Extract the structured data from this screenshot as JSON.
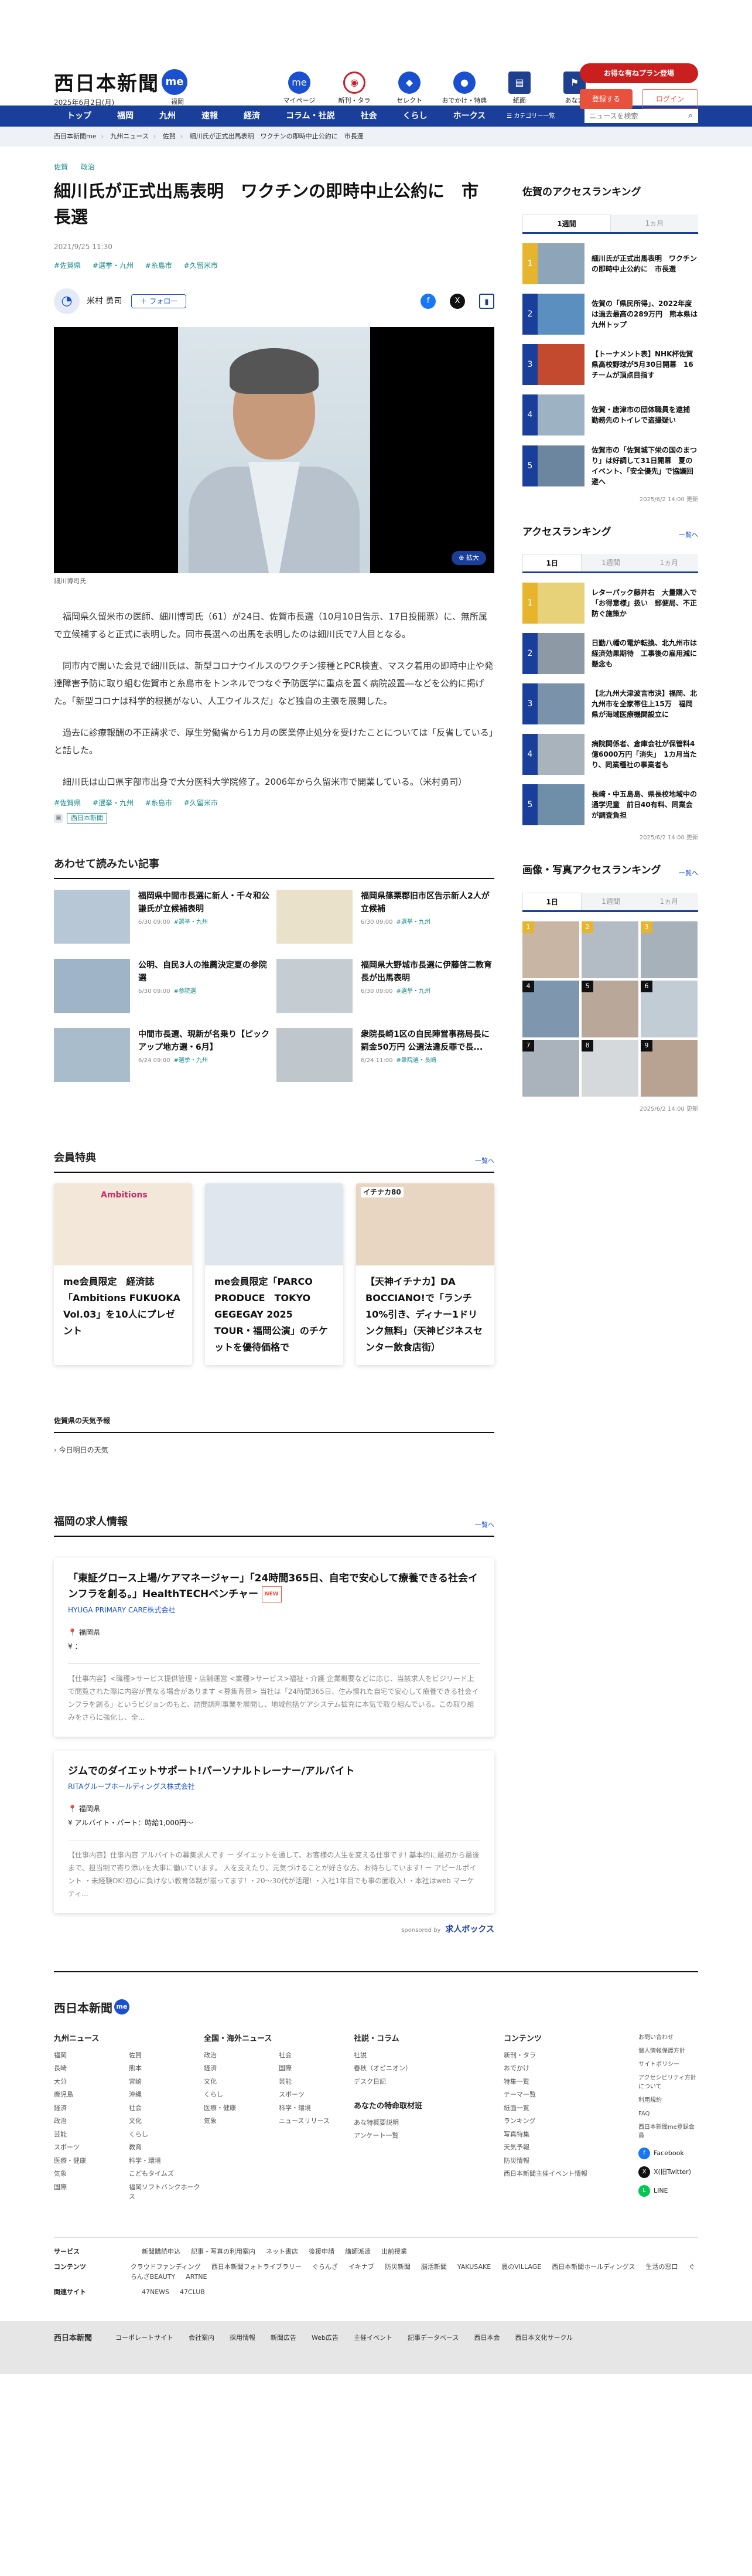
{
  "header": {
    "logo": "西日本新聞",
    "logo_badge": "me",
    "date": "2025年6月2日(月)",
    "weather": "福岡",
    "icons": [
      {
        "label": "マイページ",
        "icon": "me-icon"
      },
      {
        "label": "新刊・タラ",
        "icon": "clock-icon"
      },
      {
        "label": "セレクト",
        "icon": "tag-icon"
      },
      {
        "label": "おでかけ・特典",
        "icon": "foot-icon"
      },
      {
        "label": "紙面",
        "icon": "paper-icon"
      },
      {
        "label": "あな吉",
        "icon": "hawks-icon"
      }
    ],
    "promo_button": "お得な有ねプラン登場",
    "register_button": "登録する",
    "login_button": "ログイン"
  },
  "nav": {
    "items": [
      "トップ",
      "福岡",
      "九州",
      "速報",
      "経済",
      "コラム・社説",
      "社会",
      "くらし",
      "ホークス"
    ],
    "category_label": "カテゴリー一覧",
    "search_placeholder": "ニュースを検索"
  },
  "breadcrumb": [
    "西日本新聞me",
    "九州ニュース",
    "佐賀",
    "細川氏が正式出馬表明　ワクチンの即時中止公約に　市長選"
  ],
  "article": {
    "top_tags": [
      "佐賀",
      "政治"
    ],
    "title": "細川氏が正式出馬表明　ワクチンの即時中止公約に　市長選",
    "date": "2021/9/25 11:30",
    "tags": [
      "#佐賀県",
      "#選挙・九州",
      "#糸島市",
      "#久留米市"
    ],
    "author": "米村 勇司",
    "follow": "＋ フォロー",
    "zoom": "拡大",
    "caption": "細川博司氏",
    "paragraphs": [
      "福岡県久留米市の医師、細川博司氏（61）が24日、佐賀市長選（10月10日告示、17日投開票）に、無所属で立候補すると正式に表明した。同市長選への出馬を表明したのは細川氏で7人目となる。",
      "同市内で開いた会見で細川氏は、新型コロナウイルスのワクチン接種とPCR検査、マスク着用の即時中止や発達障害予防に取り組む佐賀市と糸島市をトンネルでつなぐ予防医学に重点を置く病院設置―などを公約に掲げた。「新型コロナは科学的根拠がない、人工ウイルスだ」など独自の主張を展開した。",
      "過去に診療報酬の不正請求で、厚生労働省から1カ月の医業停止処分を受けたことについては「反省している」と話した。",
      "細川氏は山口県宇部市出身で大分医科大学院修了。2006年から久留米市で開業している。（米村勇司）"
    ],
    "bottom_tags": [
      "#佐賀県",
      "#選挙・九州",
      "#糸島市",
      "#久留米市"
    ],
    "source": "西日本新聞"
  },
  "related": {
    "heading": "あわせて読みたい記事",
    "items": [
      {
        "title": "福岡県中間市長選に新人・千々和公謙氏が立候補表明",
        "date": "6/30 09:00",
        "tag": "#選挙・九州"
      },
      {
        "title": "福岡県篠栗郡旧市区告示新人2人が立候補",
        "date": "6/30 09:00",
        "tag": "#選挙・九州"
      },
      {
        "title": "公明、自民3人の推薦決定夏の参院選",
        "date": "6/30 09:00",
        "tag": "#参院選"
      },
      {
        "title": "福岡県大野城市長選に伊藤啓二教育長が出馬表明",
        "date": "6/30 09:00",
        "tag": "#選挙・九州"
      },
      {
        "title": "中間市長選、現新が名乗り【ピックアップ地方選・6月】",
        "date": "6/24 09:00",
        "tag": "#選挙・九州"
      },
      {
        "title": "衆院長崎1区の自民陣営事務局長に罰金50万円 公選法違反罪で長...",
        "date": "6/24 11:00",
        "tag": "#衆院選・長崎"
      }
    ]
  },
  "members": {
    "heading": "会員特典",
    "more": "一覧へ",
    "cards": [
      "me会員限定　経済誌「Ambitions FUKUOKA Vol.03」を10人にプレゼント",
      "me会員限定「PARCO PRODUCE　TOKYO GEGEGAY 2025 TOUR・福岡公演」のチケットを優待価格で",
      "【天神イチナカ】DA BOCCIANO!で「ランチ10%引き、ディナー1ドリンク無料」（天神ビジネスセンター飲食店街）"
    ],
    "card_badges": [
      "Ambitions",
      "",
      "イチナカ80"
    ]
  },
  "weather": {
    "heading": "佐賀県の天気予報",
    "sub": "今日明日の天気"
  },
  "jobs": {
    "heading": "福岡の求人情報",
    "more": "一覧へ",
    "items": [
      {
        "title": "「東証グロース上場/ケアマネージャー」「24時間365日、自宅で安心して療養できる社会インフラを創る。」HealthTECHベンチャー",
        "badge": "NEW",
        "company": "HYUGA PRIMARY CARE株式会社",
        "location": "福岡県",
        "salary": "：",
        "desc": "【仕事内容】<職種>サービス提供管理・店舗運営 <業種>サービス>福祉・介護 企業概要などに応じ、当該求人をビジリード上で閲覧された際に内容が異なる場合があります <募集背景> 当社は「24時間365日、住み慣れた自宅で安心して療養できる社会インフラを創る」というビジョンのもと、訪問調剤事業を展開し、地域包括ケアシステム拡充に本気で取り組んでいる。この取り組みをさらに強化し、全..."
      },
      {
        "title": "ジムでのダイエットサポート!パーソナルトレーナー/アルバイト",
        "badge": "",
        "company": "RITAグループホールディングス株式会社",
        "location": "福岡県",
        "salary": "アルバイト・パート：時給1,000円～",
        "desc": "【仕事内容】仕事内容 アルバイトの募集求人です ー ダイエットを通して、お客様の人生を変える仕事です! 基本的に最初から最後まで、担当制で寄り添いを大事に働いています。 人を支えたり、元気づけることが好きな方、お待ちしています! ー アピールポイント ・未経験OK!初心に負けない教育体制が揃ってます! ・20～30代が活躍! ・入社1年目でも事の面収入! ・本社はweb マーケティ..."
      }
    ],
    "sponsored": "sponsored by",
    "sponsor_name": "求人ボックス"
  },
  "sidebar": {
    "saga_ranking": {
      "heading": "佐賀のアクセスランキング",
      "tabs": [
        "1週間",
        "1ヵ月"
      ],
      "items": [
        "細川氏が正式出馬表明　ワクチンの即時中止公約に　市長選",
        "佐賀の「県民所得」、2022年度は過去最高の289万円　熊本県は九州トップ",
        "【トーナメント表】NHK杯佐賀県高校野球が5月30日開幕　16チームが頂点目指す",
        "佐賀・唐津市の団体職員を逮捕　勤務先のトイレで盗撮疑い",
        "佐賀市の「佐賀城下栄の国のまつり」は好調して31日開幕　夏のイベント、「安全優先」で協議回避へ"
      ],
      "updated": "2025/6/2 14:00 更新"
    },
    "access_ranking": {
      "heading": "アクセスランキング",
      "more": "一覧へ",
      "tabs": [
        "1日",
        "1週間",
        "1ヵ月"
      ],
      "items": [
        "レターパック藤井右　大量購入で「お得意様」扱い　郵便局、不正防ぐ施策か",
        "日勤八幡の電炉転換、北九州市は経済効果期待　工事後の雇用減に懸念も",
        "【北九州大津波言市決】福岡、北九州市を全家帯住上15万　福岡県が海域医療機関設立に",
        "病院関係者、倉庫会社が保管料4億6000万円「消失」　1カ月当たり、同業種社の事業者も",
        "長崎・中五島島、県長校地域中の通学児童　前日40有料、同業会が調査負担"
      ],
      "updated": "2025/6/2 14:00 更新"
    },
    "photo_ranking": {
      "heading": "画像・写真アクセスランキング",
      "more": "一覧へ",
      "tabs": [
        "1日",
        "1週間",
        "1ヵ月"
      ],
      "count": 9,
      "updated": "2025/6/2 14:00 更新"
    }
  },
  "footer": {
    "logo": "西日本新聞",
    "columns": [
      {
        "heading": "九州ニュース",
        "links": [
          "福岡",
          "佐賀",
          "長崎",
          "熊本",
          "大分",
          "宮崎",
          "鹿児島",
          "沖縄",
          "経済",
          "社会",
          "政治",
          "文化",
          "芸能",
          "くらし",
          "スポーツ",
          "教育",
          "医療・健康",
          "科学・環境",
          "気象",
          "こどもタイムズ",
          "国際",
          "福岡ソフトバンクホークス"
        ]
      },
      {
        "heading": "全国・海外ニュース",
        "links": [
          "政治",
          "社会",
          "経済",
          "国際",
          "文化",
          "芸能",
          "くらし",
          "スポーツ",
          "医療・健康",
          "科学・環境",
          "気象",
          "ニュースリリース"
        ]
      },
      {
        "heading": "社説・コラム",
        "links": [
          "社説",
          "春秋（オピニオン）",
          "デスク日記"
        ]
      },
      {
        "heading": "コンテンツ",
        "links": [
          "新刊・タラ",
          "おでかけ",
          "特集一覧",
          "テーマ一覧",
          "紙面一覧",
          "ランキング",
          "写真特集",
          "天気予報",
          "防災情報",
          "西日本新聞主催イベント情報"
        ]
      }
    ],
    "col3b_heading": "あなたの特命取材班",
    "col3b_links": [
      "あな特概要説明",
      "アンケート一覧"
    ],
    "small_links": [
      "お問い合わせ",
      "個人情報保護方針",
      "サイトポリシー",
      "アクセシビリティ方針について",
      "利用規約",
      "FAQ",
      "西日本新聞me登録会員"
    ],
    "sns": [
      "Facebook",
      "X(旧Twitter)",
      "LINE"
    ],
    "rows": [
      {
        "key": "サービス",
        "values": [
          "新聞購読申込",
          "記事・写真の利用案内",
          "ネット書店",
          "後援申請",
          "講師派遣",
          "出前授業"
        ]
      },
      {
        "key": "コンテンツ",
        "values": [
          "クラウドファンディング",
          "西日本新聞フォトライブラリー",
          "ぐらんざ",
          "イキナブ",
          "防災新聞",
          "脳活新聞",
          "YAKUSAKE",
          "農のVILLAGE",
          "西日本新聞ホールディングス",
          "生活の窓口",
          "ぐらんざBEAUTY",
          "ARTNE"
        ]
      },
      {
        "key": "関連サイト",
        "values": [
          "47NEWS",
          "47CLUB"
        ]
      }
    ],
    "bottom_logo": "西日本新聞",
    "bottom_links": [
      "コーポレートサイト",
      "会社案内",
      "採用情報",
      "新聞広告",
      "Web広告",
      "主催イベント",
      "記事データベース",
      "西日本会",
      "西日本文化サークル"
    ]
  }
}
